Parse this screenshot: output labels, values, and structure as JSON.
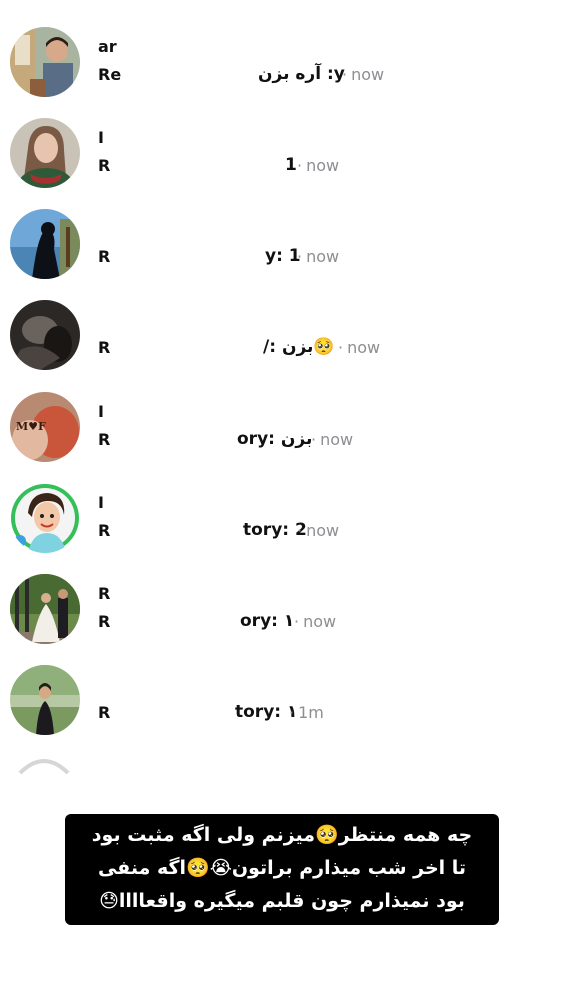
{
  "rows": [
    {
      "name": "ar",
      "sub": "Re",
      "story": "آره بزن :y",
      "time": "now"
    },
    {
      "name": "I",
      "sub": "R",
      "story": "1",
      "time": "now"
    },
    {
      "name": "",
      "sub": "R",
      "story": "y: 1",
      "time": "now"
    },
    {
      "name": "",
      "sub": "R",
      "story": "/: بزن🥺",
      "time": "now"
    },
    {
      "name": "I",
      "sub": "R",
      "story": "ory: بزن",
      "time": "now"
    },
    {
      "name": "I",
      "sub": "R",
      "story": "tory: 2",
      "time": "now"
    },
    {
      "name": "R",
      "sub": "R",
      "story": "ory: ۱",
      "time": "now"
    },
    {
      "name": "",
      "sub": "R",
      "story": "tory: ۱",
      "time": "1m"
    }
  ],
  "time_separator": "·",
  "caption": {
    "line1": "چه همه منتظر🥺میزنم ولی اگه مثبت بود",
    "line2": "تا اخر شب میذارم براتون😭🥺اگه منفی",
    "line3": "بود نمیذارم چون قلبم میگیره واقعاااا😓"
  },
  "avatar_icons": [
    "child-photo-icon",
    "woman-portrait-icon",
    "beach-silhouette-icon",
    "dark-photo-icon",
    "couple-text-icon",
    "cartoon-avatar-icon",
    "wedding-photo-icon",
    "garden-photo-icon"
  ]
}
